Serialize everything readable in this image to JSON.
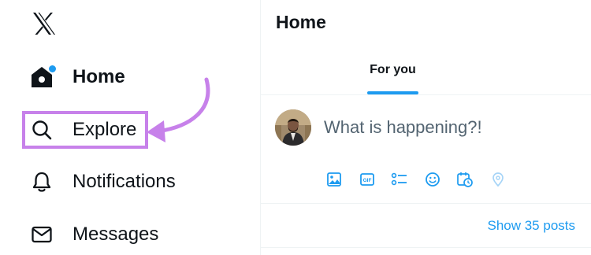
{
  "sidebar": {
    "logo_icon": "x-logo-icon",
    "items": [
      {
        "label": "Home",
        "icon": "home-icon",
        "active": true,
        "badge_dot": true
      },
      {
        "label": "Explore",
        "icon": "search-icon",
        "highlighted": true
      },
      {
        "label": "Notifications",
        "icon": "bell-icon"
      },
      {
        "label": "Messages",
        "icon": "envelope-icon"
      }
    ],
    "annotation": {
      "color": "#c781ea",
      "arrow_target": "Explore"
    }
  },
  "main": {
    "title": "Home",
    "tabs": [
      {
        "label": "For you",
        "active": true
      }
    ],
    "compose": {
      "placeholder": "What is happening?!",
      "toolbar_icons": [
        "image-icon",
        "gif-icon",
        "poll-icon",
        "emoji-icon",
        "schedule-icon",
        "location-icon"
      ]
    },
    "show_posts_label": "Show 35 posts"
  },
  "colors": {
    "accent": "#1d9bf0",
    "text": "#0f1419",
    "muted": "#536471",
    "border": "#eff3f4"
  }
}
